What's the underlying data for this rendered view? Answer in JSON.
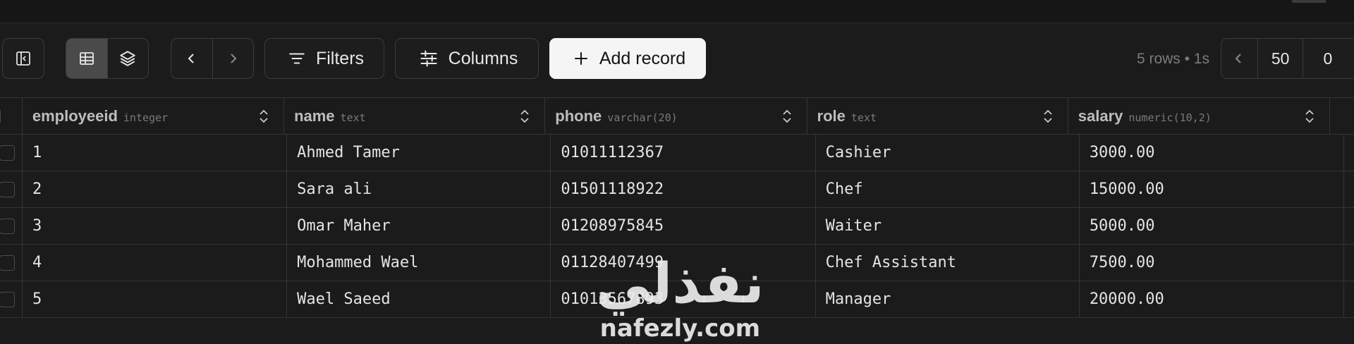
{
  "toolbar": {
    "filters_label": "Filters",
    "columns_label": "Columns",
    "add_record_label": "Add record",
    "status": "5 rows • 1s",
    "pager": {
      "limit": "50",
      "offset": "0"
    }
  },
  "table": {
    "columns": [
      {
        "name": "employeeid",
        "type": "integer"
      },
      {
        "name": "name",
        "type": "text"
      },
      {
        "name": "phone",
        "type": "varchar(20)"
      },
      {
        "name": "role",
        "type": "text"
      },
      {
        "name": "salary",
        "type": "numeric(10,2)"
      }
    ],
    "rows": [
      [
        "1",
        "Ahmed Tamer",
        "01011112367",
        "Cashier",
        "3000.00"
      ],
      [
        "2",
        "Sara ali",
        "01501118922",
        "Chef",
        "15000.00"
      ],
      [
        "3",
        "Omar Maher",
        "01208975845",
        "Waiter",
        "5000.00"
      ],
      [
        "4",
        "Mohammed Wael",
        "01128407499",
        "Chef Assistant",
        "7500.00"
      ],
      [
        "5",
        "Wael Saeed",
        "01013567893",
        "Manager",
        "20000.00"
      ]
    ]
  },
  "watermark": {
    "arabic": "نفذلي",
    "latin": "nafezly.com"
  }
}
